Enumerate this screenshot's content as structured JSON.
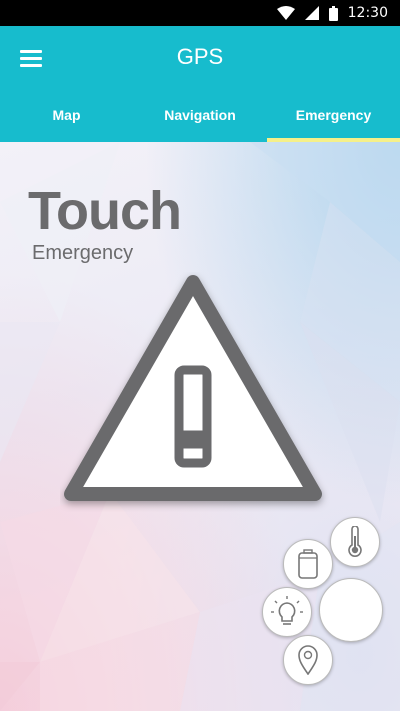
{
  "status_bar": {
    "time": "12:30",
    "icons": [
      "wifi-icon",
      "signal-icon",
      "battery-icon"
    ]
  },
  "app_bar": {
    "title": "GPS",
    "menu_icon": "hamburger-menu-icon",
    "background_color": "#17bccd",
    "tabs": [
      {
        "label": "Map",
        "active": false
      },
      {
        "label": "Navigation",
        "active": false
      },
      {
        "label": "Emergency",
        "active": true
      }
    ],
    "active_tab_indicator_color": "#f5f08a"
  },
  "main": {
    "heading": "Touch",
    "subheading": "Emergency",
    "warning_icon": "warning-triangle-icon",
    "text_color": "#6b6b6d"
  },
  "quick_actions": [
    {
      "name": "temperature",
      "icon": "thermometer-icon"
    },
    {
      "name": "battery",
      "icon": "battery-cylinder-icon"
    },
    {
      "name": "light",
      "icon": "lightbulb-icon"
    },
    {
      "name": "center",
      "icon": "blank-circle"
    },
    {
      "name": "location",
      "icon": "location-pin-icon"
    }
  ]
}
